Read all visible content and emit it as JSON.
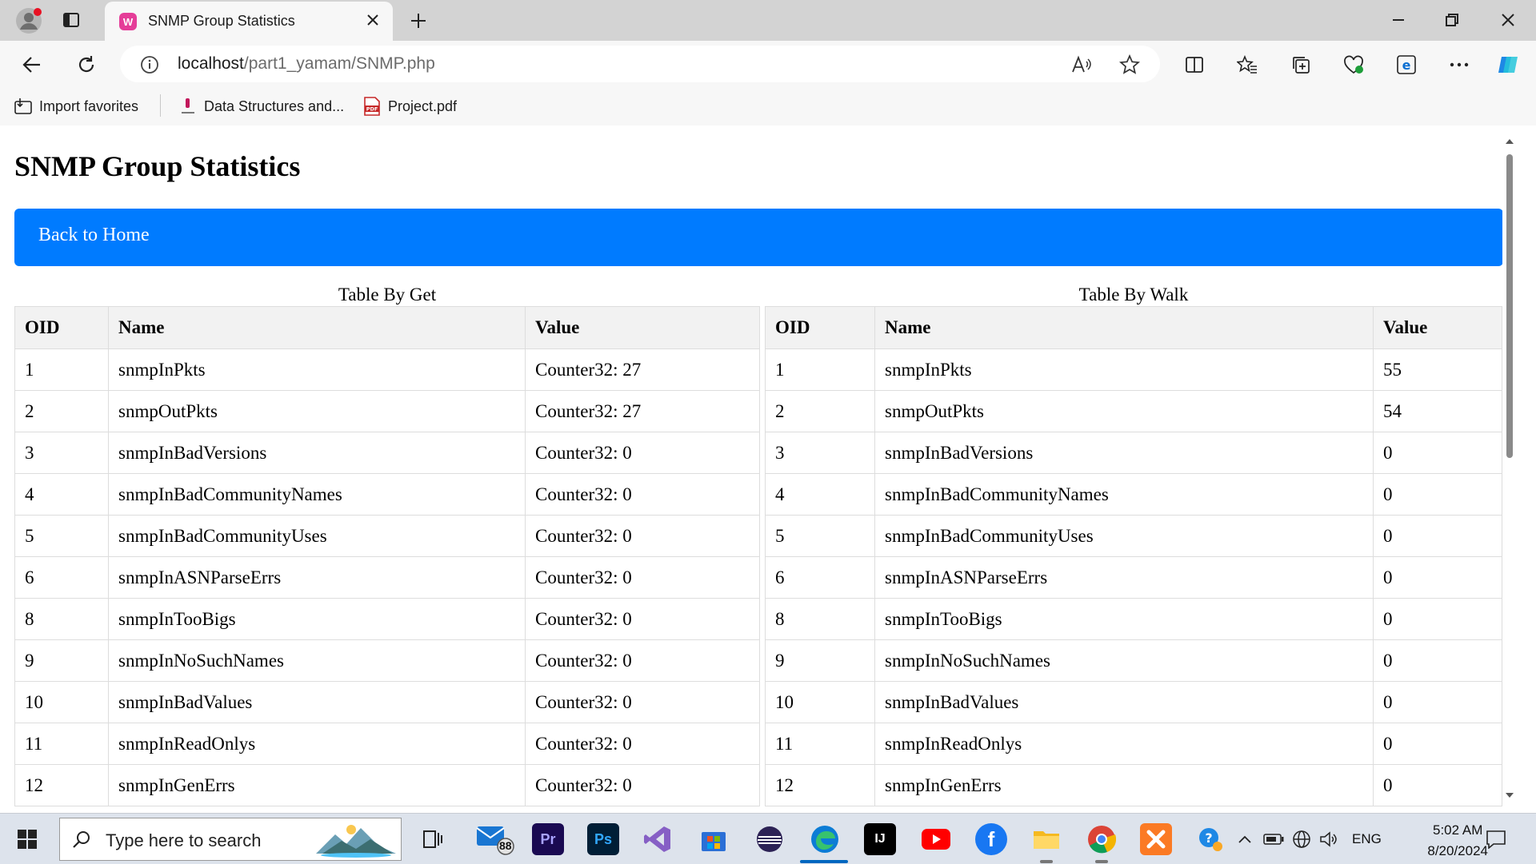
{
  "browser": {
    "tab_title": "SNMP Group Statistics",
    "url_host": "localhost",
    "url_path": "/part1_yamam/SNMP.php",
    "favorites": [
      {
        "label": "Import favorites",
        "icon": "import-icon"
      },
      {
        "label": "Data Structures and...",
        "icon": "page-favicon"
      },
      {
        "label": "Project.pdf",
        "icon": "pdf-icon"
      }
    ]
  },
  "page": {
    "title": "SNMP Group Statistics",
    "home_button": "Back to Home",
    "colors": {
      "button": "#007bff",
      "header_bg": "#f2f2f2"
    }
  },
  "tables": {
    "get": {
      "caption": "Table By Get",
      "headers": [
        "OID",
        "Name",
        "Value"
      ],
      "rows": [
        [
          "1",
          "snmpInPkts",
          "Counter32: 27"
        ],
        [
          "2",
          "snmpOutPkts",
          "Counter32: 27"
        ],
        [
          "3",
          "snmpInBadVersions",
          "Counter32: 0"
        ],
        [
          "4",
          "snmpInBadCommunityNames",
          "Counter32: 0"
        ],
        [
          "5",
          "snmpInBadCommunityUses",
          "Counter32: 0"
        ],
        [
          "6",
          "snmpInASNParseErrs",
          "Counter32: 0"
        ],
        [
          "8",
          "snmpInTooBigs",
          "Counter32: 0"
        ],
        [
          "9",
          "snmpInNoSuchNames",
          "Counter32: 0"
        ],
        [
          "10",
          "snmpInBadValues",
          "Counter32: 0"
        ],
        [
          "11",
          "snmpInReadOnlys",
          "Counter32: 0"
        ],
        [
          "12",
          "snmpInGenErrs",
          "Counter32: 0"
        ]
      ]
    },
    "walk": {
      "caption": "Table By Walk",
      "headers": [
        "OID",
        "Name",
        "Value"
      ],
      "rows": [
        [
          "1",
          "snmpInPkts",
          "55"
        ],
        [
          "2",
          "snmpOutPkts",
          "54"
        ],
        [
          "3",
          "snmpInBadVersions",
          "0"
        ],
        [
          "4",
          "snmpInBadCommunityNames",
          "0"
        ],
        [
          "5",
          "snmpInBadCommunityUses",
          "0"
        ],
        [
          "6",
          "snmpInASNParseErrs",
          "0"
        ],
        [
          "8",
          "snmpInTooBigs",
          "0"
        ],
        [
          "9",
          "snmpInNoSuchNames",
          "0"
        ],
        [
          "10",
          "snmpInBadValues",
          "0"
        ],
        [
          "11",
          "snmpInReadOnlys",
          "0"
        ],
        [
          "12",
          "snmpInGenErrs",
          "0"
        ]
      ]
    }
  },
  "taskbar": {
    "search_placeholder": "Type here to search",
    "mail_badge": "88",
    "language": "ENG",
    "time": "5:02 AM",
    "date": "8/20/2024",
    "apps": [
      {
        "name": "task-view-icon"
      },
      {
        "name": "mail-icon"
      },
      {
        "name": "premiere-icon",
        "text": "Pr"
      },
      {
        "name": "photoshop-icon",
        "text": "Ps"
      },
      {
        "name": "visual-studio-icon"
      },
      {
        "name": "microsoft-store-icon"
      },
      {
        "name": "eclipse-icon"
      },
      {
        "name": "edge-icon"
      },
      {
        "name": "intellij-icon",
        "text": "IJ"
      },
      {
        "name": "youtube-icon"
      },
      {
        "name": "facebook-icon",
        "text": "f"
      },
      {
        "name": "file-explorer-icon"
      },
      {
        "name": "chrome-icon"
      },
      {
        "name": "xampp-icon"
      }
    ]
  }
}
